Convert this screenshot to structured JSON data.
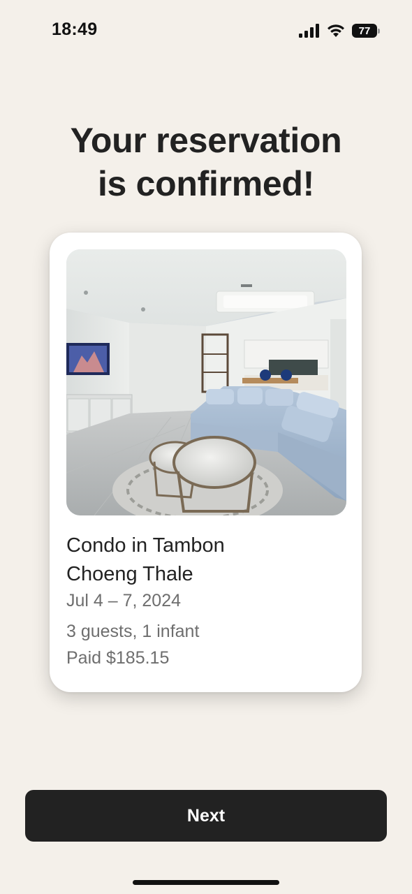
{
  "status_bar": {
    "time": "18:49",
    "battery_level": "77",
    "icons": [
      "signal-icon",
      "wifi-icon",
      "battery-icon"
    ]
  },
  "confirmation": {
    "headline_line1": "Your reservation",
    "headline_line2": "is confirmed!"
  },
  "listing": {
    "title_line1": "Condo in Tambon",
    "title_line2": "Choeng Thale",
    "dates": "Jul 4 – 7, 2024",
    "guests": "3 guests, 1 infant",
    "paid": "Paid $185.15"
  },
  "actions": {
    "next_label": "Next"
  },
  "colors": {
    "background": "#f4f0ea",
    "button": "#222222",
    "card": "#ffffff",
    "secondary_text": "#6e6e6e"
  }
}
